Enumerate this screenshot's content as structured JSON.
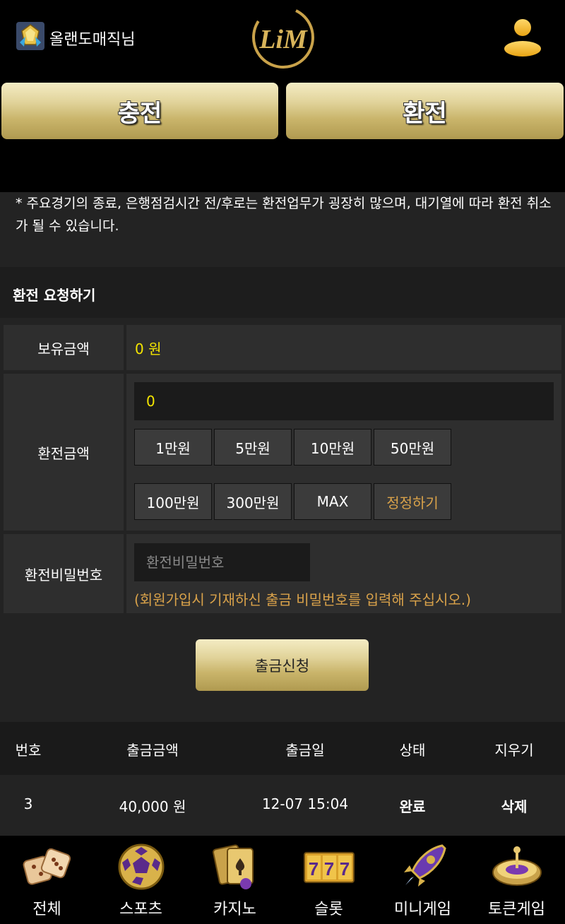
{
  "header": {
    "user_name": "올랜도매직님",
    "logo_text": "LiM",
    "user_icon": "gem-rank-icon",
    "profile_icon": "user-profile-icon"
  },
  "top_buttons": {
    "deposit": "충전",
    "exchange": "환전"
  },
  "notice": "* 주요경기의 종료, 은행점검시간 전/후로는 환전업무가 굉장히 많으며, 대기열에 따라 환전 취소가 될 수 있습니다.",
  "form": {
    "title": "환전 요청하기",
    "balance_label": "보유금액",
    "balance_value": "0 원",
    "amount_label": "환전금액",
    "amount_value": "0",
    "quick_amounts": [
      "1만원",
      "5만원",
      "10만원",
      "50만원",
      "100만원",
      "300만원",
      "MAX",
      "정정하기"
    ],
    "password_label": "환전비밀번호",
    "password_placeholder": "환전비밀번호",
    "password_hint": "(회원가입시 기재하신 출금 비밀번호를 입력해 주십시오.)",
    "submit": "출금신청"
  },
  "table": {
    "headers": [
      "번호",
      "출금금액",
      "출금일",
      "상태",
      "지우기"
    ],
    "rows": [
      {
        "no": "3",
        "amount": "40,000 원",
        "date": "12-07 15:04",
        "status": "완료",
        "action": "삭제"
      }
    ]
  },
  "bottom_nav": [
    {
      "label": "전체",
      "icon": "dice-icon"
    },
    {
      "label": "스포츠",
      "icon": "soccer-ball-icon"
    },
    {
      "label": "카지노",
      "icon": "cards-icon"
    },
    {
      "label": "슬롯",
      "icon": "slot-777-icon"
    },
    {
      "label": "미니게임",
      "icon": "rocket-icon"
    },
    {
      "label": "토큰게임",
      "icon": "roulette-icon"
    }
  ],
  "colors": {
    "accent_gold": "#d9a24a",
    "value_yellow": "#f4e500",
    "panel": "#2e2e2e",
    "background": "#232323"
  }
}
